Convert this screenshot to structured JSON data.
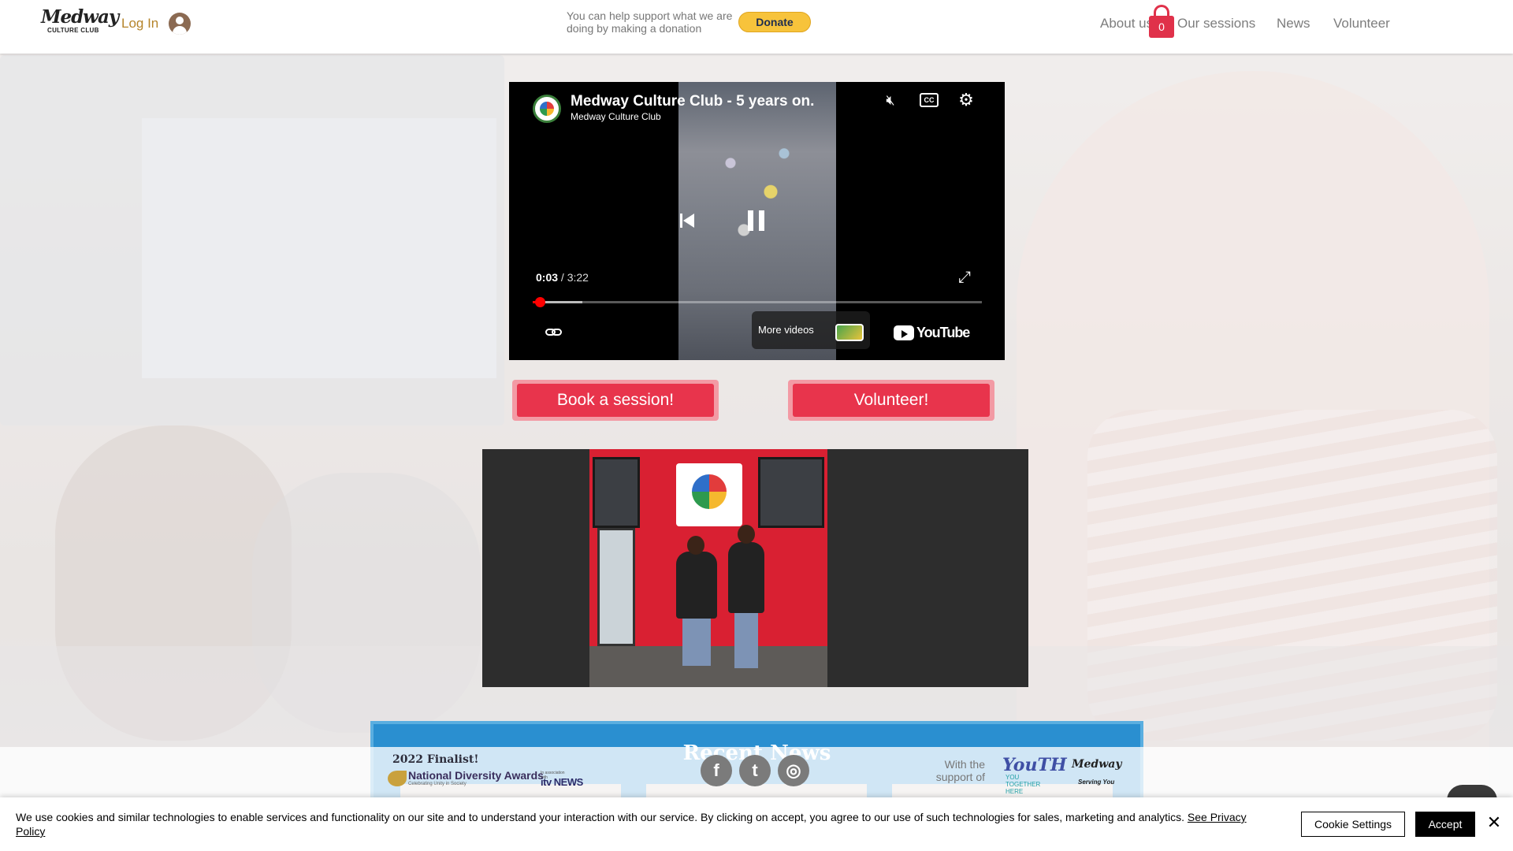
{
  "header": {
    "logo_line1": "Medway",
    "logo_line2": "CULTURE CLUB",
    "login_label": "Log In",
    "support_text": "You can help support what we are doing by making a donation",
    "donate_label": "Donate",
    "nav": [
      {
        "label": "About us"
      },
      {
        "label": "Our sessions"
      },
      {
        "label": "News"
      },
      {
        "label": "Volunteer"
      }
    ],
    "cart_count": "0"
  },
  "video": {
    "title": "Medway Culture Club - 5 years on.",
    "channel": "Medway Culture Club",
    "current_time": "0:03",
    "duration": "3:22",
    "progress_fraction": 0.015,
    "loaded_fraction": 0.11,
    "more_videos_label": "More videos",
    "platform_name": "YouTube",
    "icons": [
      "mute-icon",
      "captions-icon",
      "settings-icon",
      "previous-icon",
      "pause-icon",
      "fullscreen-icon",
      "link-icon"
    ]
  },
  "cta": {
    "book_label": "Book a session!",
    "volunteer_label": "Volunteer!"
  },
  "news": {
    "title": "Recent News"
  },
  "footer": {
    "finalist_text": "2022 Finalist!",
    "award_name": "National Diversity Awards",
    "award_tagline": "Celebrating Unity in Society",
    "itv_note": "In association with",
    "itv_label": "itv NEWS",
    "social": [
      {
        "name": "facebook",
        "glyph": "f"
      },
      {
        "name": "twitter",
        "glyph": "t"
      },
      {
        "name": "instagram",
        "glyph": "◎"
      }
    ],
    "support_of_text": "With the support of",
    "youth_label": "YouTH",
    "youth_sub": "YOU TOGETHER HERE",
    "medway_label": "Medway",
    "medway_sub": "Serving You"
  },
  "cookie": {
    "message": "We use cookies and similar technologies to enable services and functionality on our site and to understand your interaction with our service. By clicking on accept, you agree to our use of such technologies for sales, marketing and analytics.",
    "privacy_link": "See Privacy Policy",
    "settings_label": "Cookie Settings",
    "accept_label": "Accept",
    "close_glyph": "✕"
  },
  "colors": {
    "brand_red": "#e8344c",
    "brand_gold": "#b5842a",
    "news_blue": "#2a8fd0",
    "donate_yellow": "#f7c33b"
  }
}
